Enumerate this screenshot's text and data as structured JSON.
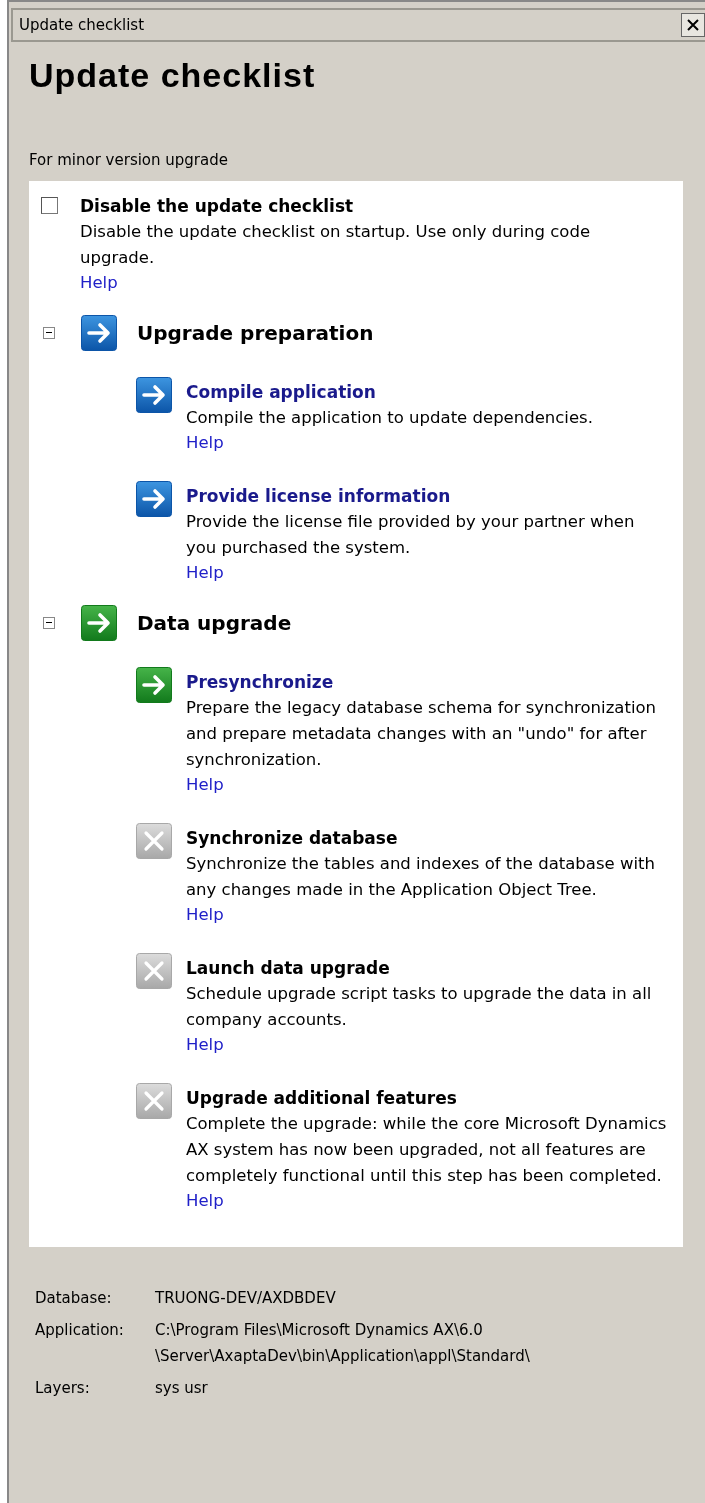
{
  "window": {
    "title": "Update checklist"
  },
  "heading": "Update checklist",
  "subtitle": "For minor version upgrade",
  "disable_option": {
    "label": "Disable the update checklist",
    "checked": false,
    "description": "Disable the update checklist on startup. Use only during code upgrade.",
    "help": "Help"
  },
  "groups": [
    {
      "title": "Upgrade preparation",
      "expanded": true,
      "kind": "ready",
      "items": [
        {
          "title": "Compile application",
          "kind": "ready",
          "description": "Compile the application to update dependencies.",
          "help": "Help"
        },
        {
          "title": "Provide license information",
          "kind": "ready",
          "description": "Provide the license file provided by your partner when you purchased the system.",
          "help": "Help"
        }
      ]
    },
    {
      "title": "Data upgrade",
      "expanded": true,
      "kind": "current",
      "items": [
        {
          "title": "Presynchronize",
          "kind": "current",
          "description": "Prepare the legacy database schema for synchronization and prepare metadata changes with an \"undo\" for after synchronization.",
          "help": "Help"
        },
        {
          "title": "Synchronize database",
          "kind": "unavailable",
          "description": "Synchronize the tables and indexes of the database with any changes made in the Application Object Tree.",
          "help": "Help"
        },
        {
          "title": "Launch data upgrade",
          "kind": "unavailable",
          "description": "Schedule upgrade script tasks to upgrade the data in all company accounts.",
          "help": "Help"
        },
        {
          "title": "Upgrade additional features",
          "kind": "unavailable",
          "description": "Complete the upgrade: while the core Microsoft Dynamics AX system has now been upgraded, not all features are completely functional until this step has been completed.",
          "help": "Help"
        }
      ]
    }
  ],
  "info": [
    {
      "label": "Database:",
      "lines": [
        "TRUONG-DEV/AXDBDEV"
      ]
    },
    {
      "label": "Application:",
      "lines": [
        "C:\\Program Files\\Microsoft Dynamics AX\\6.0",
        "\\Server\\AxaptaDev\\bin\\Application\\appl\\Standard\\"
      ]
    },
    {
      "label": "Layers:",
      "lines": [
        "sys usr"
      ]
    }
  ]
}
